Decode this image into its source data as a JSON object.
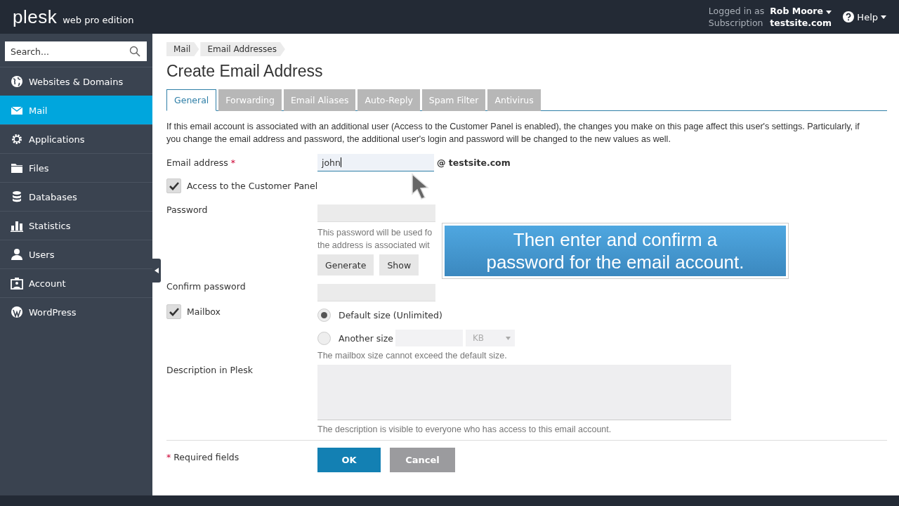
{
  "header": {
    "logo": "plesk",
    "edition": "web pro edition",
    "logged_in_label": "Logged in as",
    "user": "Rob Moore",
    "subscription_label": "Subscription",
    "subscription": "testsite.com",
    "help": "Help"
  },
  "sidebar": {
    "search_placeholder": "Search...",
    "items": [
      {
        "label": "Websites & Domains",
        "kind": "globe",
        "selected": false
      },
      {
        "label": "Mail",
        "kind": "mail",
        "selected": true
      },
      {
        "label": "Applications",
        "kind": "gear",
        "selected": false
      },
      {
        "label": "Files",
        "kind": "folder",
        "selected": false
      },
      {
        "label": "Databases",
        "kind": "database",
        "selected": false
      },
      {
        "label": "Statistics",
        "kind": "bars",
        "selected": false
      },
      {
        "label": "Users",
        "kind": "user",
        "selected": false
      },
      {
        "label": "Account",
        "kind": "card",
        "selected": false
      },
      {
        "label": "WordPress",
        "kind": "wordpress",
        "selected": false
      }
    ]
  },
  "breadcrumbs": [
    "Mail",
    "Email Addresses"
  ],
  "title": "Create Email Address",
  "tabs": [
    {
      "label": "General",
      "selected": true
    },
    {
      "label": "Forwarding",
      "selected": false
    },
    {
      "label": "Email Aliases",
      "selected": false
    },
    {
      "label": "Auto-Reply",
      "selected": false
    },
    {
      "label": "Spam Filter",
      "selected": false
    },
    {
      "label": "Antivirus",
      "selected": false
    }
  ],
  "notice": "If this email account is associated with an additional user (Access to the Customer Panel is enabled), the changes you make on this page affect this user's settings. Particularly, if you change the email address and password, the additional user's login and password will be changed to the new values as well.",
  "form": {
    "email_label": "Email address",
    "required_mark": "*",
    "email_value": "john",
    "domain": "@ testsite.com",
    "customer_panel": {
      "label": "Access to the Customer Panel",
      "checked": true
    },
    "password_label": "Password",
    "password_hint": [
      "This password will be used fo",
      "the address is associated wit"
    ],
    "generate": "Generate",
    "show": "Show",
    "confirm_label": "Confirm password",
    "mailbox": {
      "label": "Mailbox",
      "checked": true
    },
    "size_options": [
      {
        "label": "Default size (Unlimited)",
        "selected": true
      },
      {
        "label": "Another size",
        "selected": false
      }
    ],
    "size_unit": "KB",
    "size_hint": "The mailbox size cannot exceed the default size.",
    "description_label": "Description in Plesk",
    "description_hint": "The description is visible to everyone who has access to this email account.",
    "required_note": "Required fields",
    "ok": "OK",
    "cancel": "Cancel"
  },
  "callout": "Then enter and confirm a password for the email account."
}
